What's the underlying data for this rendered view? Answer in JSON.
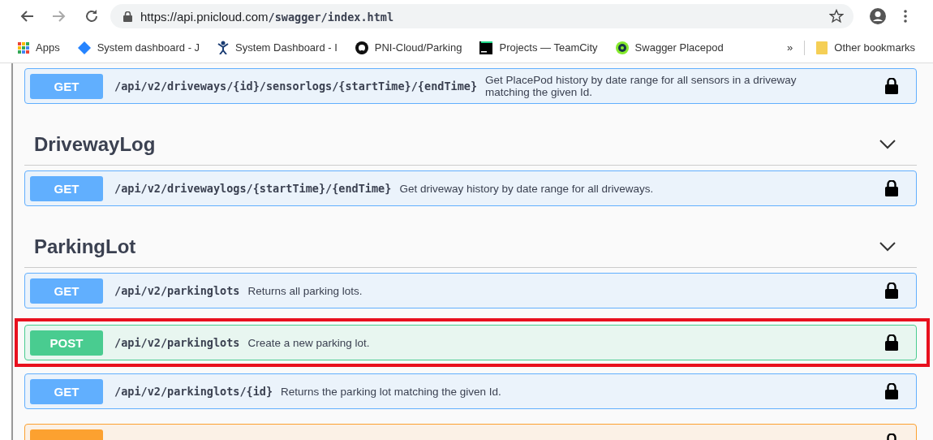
{
  "browser": {
    "url_host": "https://api.pnicloud.com",
    "url_path": "/swagger/index.html",
    "bookmarks": [
      {
        "label": "Apps"
      },
      {
        "label": "System dashboard - J"
      },
      {
        "label": "System Dashboard - I"
      },
      {
        "label": "PNI-Cloud/Parking"
      },
      {
        "label": "Projects — TeamCity"
      },
      {
        "label": "Swagger Placepod"
      }
    ],
    "overflow": "»",
    "other_bookmarks": "Other bookmarks"
  },
  "sections": [
    {
      "operations": [
        {
          "method": "GET",
          "path": "/api/v2/driveways/{id}/sensorlogs/{startTime}/{endTime}",
          "summary": "Get PlacePod history by date range for all sensors in a driveway matching the given Id.",
          "highlighted": false
        }
      ]
    },
    {
      "title": "DrivewayLog",
      "operations": [
        {
          "method": "GET",
          "path": "/api/v2/drivewaylogs/{startTime}/{endTime}",
          "summary": "Get driveway history by date range for all driveways.",
          "highlighted": false
        }
      ]
    },
    {
      "title": "ParkingLot",
      "operations": [
        {
          "method": "GET",
          "path": "/api/v2/parkinglots",
          "summary": "Returns all parking lots.",
          "highlighted": false
        },
        {
          "method": "POST",
          "path": "/api/v2/parkinglots",
          "summary": "Create a new parking lot.",
          "highlighted": true
        },
        {
          "method": "GET",
          "path": "/api/v2/parkinglots/{id}",
          "summary": "Returns the parking lot matching the given Id.",
          "highlighted": false
        },
        {
          "kind": "put",
          "highlighted": false
        }
      ]
    }
  ]
}
